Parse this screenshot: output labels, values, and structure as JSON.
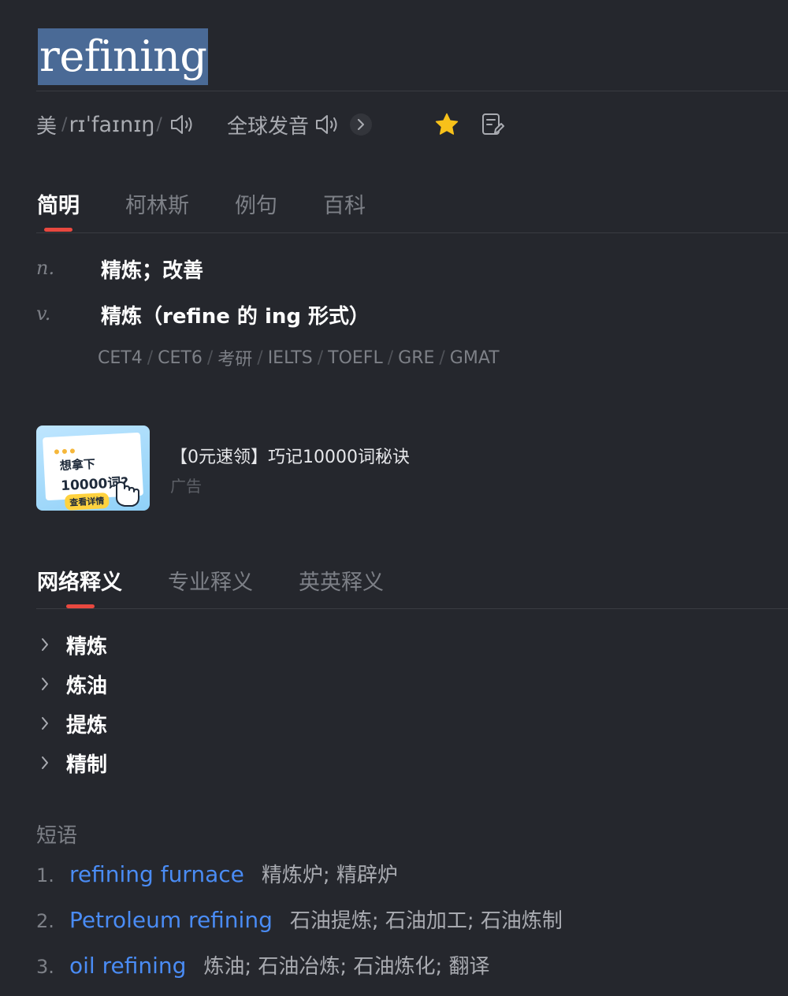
{
  "word": "refining",
  "pronunciation": {
    "region": "美",
    "phonetic": "rɪˈfaɪnɪŋ",
    "global_label": "全球发音"
  },
  "tabs": [
    "简明",
    "柯林斯",
    "例句",
    "百科"
  ],
  "definitions": [
    {
      "pos": "n.",
      "text": "精炼；改善"
    },
    {
      "pos": "v.",
      "text": "精炼（refine 的 ing 形式）"
    }
  ],
  "exam_tags": [
    "CET4",
    "CET6",
    "考研",
    "IELTS",
    "TOEFL",
    "GRE",
    "GMAT"
  ],
  "ad": {
    "image_line1": "想拿下",
    "image_line2": "10000词?",
    "image_button": "查看详情",
    "title": "【0元速领】巧记10000词秘诀",
    "label": "广告"
  },
  "net_tabs": [
    "网络释义",
    "专业释义",
    "英英释义"
  ],
  "net_items": [
    "精炼",
    "炼油",
    "提炼",
    "精制"
  ],
  "phrases_title": "短语",
  "phrases": [
    {
      "num": "1.",
      "en": "refining furnace",
      "cn": "精炼炉; 精辟炉"
    },
    {
      "num": "2.",
      "en": "Petroleum refining",
      "cn": "石油提炼; 石油加工; 石油炼制"
    },
    {
      "num": "3.",
      "en": "oil refining",
      "cn": "炼油; 石油冶炼; 石油炼化; 翻译"
    }
  ],
  "colors": {
    "background": "#25272d",
    "accent_underline": "#e8483f",
    "star": "#f7c11a",
    "link": "#4a8cf5",
    "selection": "#4a6a96"
  },
  "icons": [
    "speaker-icon",
    "chevron-right-icon",
    "star-icon",
    "note-edit-icon"
  ]
}
